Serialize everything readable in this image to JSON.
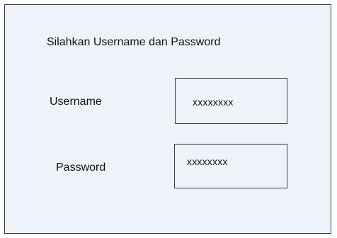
{
  "form": {
    "heading": "Silahkan Username dan Password",
    "username": {
      "label": "Username",
      "value": "xxxxxxxx"
    },
    "password": {
      "label": "Password",
      "value": "xxxxxxxx"
    }
  },
  "colors": {
    "background": "#eef3fa",
    "border": "#3a3a3a",
    "text": "#111111"
  }
}
